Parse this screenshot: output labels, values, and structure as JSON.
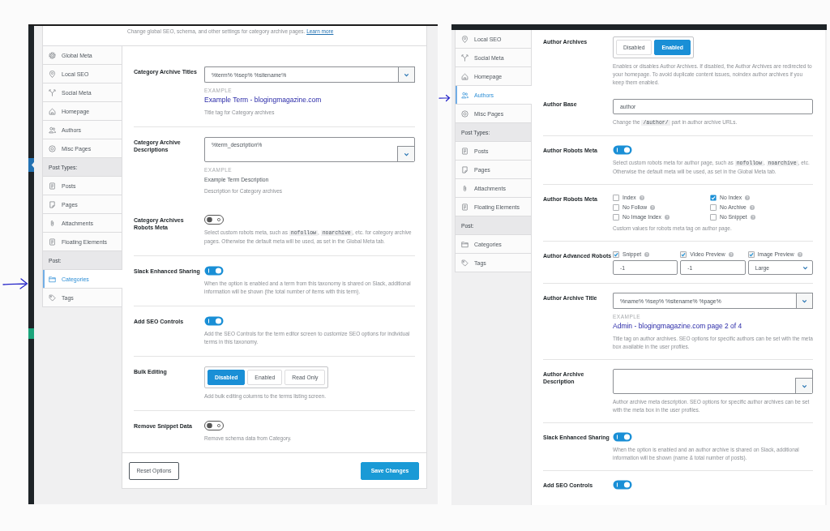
{
  "left_screenshot": {
    "header": {
      "text": "Change global SEO, schema, and other settings for category archive pages.",
      "link": "Learn more"
    },
    "sidebar": {
      "items": [
        {
          "kind": "link",
          "label": "Global Meta",
          "selected": false
        },
        {
          "kind": "link",
          "label": "Local SEO",
          "selected": false
        },
        {
          "kind": "link",
          "label": "Social Meta",
          "selected": false
        },
        {
          "kind": "link",
          "label": "Homepage",
          "selected": false
        },
        {
          "kind": "link",
          "label": "Authors",
          "selected": false
        },
        {
          "kind": "link",
          "label": "Misc Pages",
          "selected": false
        },
        {
          "kind": "heading",
          "label": "Post Types:"
        },
        {
          "kind": "link",
          "label": "Posts",
          "selected": false
        },
        {
          "kind": "link",
          "label": "Pages",
          "selected": false
        },
        {
          "kind": "link",
          "label": "Attachments",
          "selected": false
        },
        {
          "kind": "link",
          "label": "Floating Elements",
          "selected": false
        },
        {
          "kind": "heading",
          "label": "Post:"
        },
        {
          "kind": "link",
          "label": "Categories",
          "selected": true
        },
        {
          "kind": "link",
          "label": "Tags",
          "selected": false
        }
      ]
    },
    "sections": [
      {
        "rows": [
          {
            "kind": "select",
            "label": "Category Archive Titles",
            "value": "%term% %sep% %sitename%",
            "example_label": "EXAMPLE",
            "example": "Example Term - blogingmagazine.com",
            "description": "Title tag for Category archives"
          }
        ]
      },
      {
        "rows": [
          {
            "kind": "textarea",
            "label": "Category Archive Descriptions",
            "value": "%term_description%",
            "example_label": "EXAMPLE",
            "example": "Example Term Description",
            "description": "Description for Category archives"
          },
          {
            "kind": "toggle",
            "label": "Category Archives Robots Meta",
            "on": false,
            "description": [
              {
                "kind": "text",
                "text": "Select custom robots meta, such as "
              },
              {
                "kind": "code",
                "text": "nofollow"
              },
              {
                "kind": "text",
                "text": ", "
              },
              {
                "kind": "code",
                "text": "noarchive"
              },
              {
                "kind": "text",
                "text": ", etc. for category archive pages. Otherwise the default meta will be used, as set in the Global Meta tab."
              }
            ]
          }
        ]
      },
      {
        "rows": [
          {
            "kind": "toggle",
            "label": "Slack Enhanced Sharing",
            "on": true,
            "description": "When the option is enabled and a term from this taxonomy is shared on Slack, additional information will be shown (the total number of items with this term)."
          }
        ]
      },
      {
        "rows": [
          {
            "kind": "toggle",
            "label": "Add SEO Controls",
            "on": true,
            "description": "Add the SEO Controls for the term editor screen to customize SEO options for individual terms in this taxonomy."
          }
        ]
      },
      {
        "rows": [
          {
            "kind": "segmented",
            "label": "Bulk Editing",
            "options": [
              {
                "label": "Disabled",
                "selected": true
              },
              {
                "label": "Enabled",
                "selected": false
              },
              {
                "label": "Read Only",
                "selected": false
              }
            ],
            "description": "Add bulk editing columns to the terms listing screen."
          }
        ]
      },
      {
        "rows": [
          {
            "kind": "toggle",
            "label": "Remove Snippet Data",
            "on": false,
            "description": "Remove schema data from Category."
          }
        ]
      }
    ],
    "footer": {
      "buttons": [
        {
          "kind": "secondary",
          "label": "Reset Options"
        },
        {
          "kind": "primary",
          "label": "Save Changes"
        }
      ]
    }
  },
  "right_screenshot": {
    "sidebar": {
      "items": [
        {
          "kind": "link",
          "label": "Local SEO",
          "selected": false
        },
        {
          "kind": "link",
          "label": "Social Meta",
          "selected": false
        },
        {
          "kind": "link",
          "label": "Homepage",
          "selected": false
        },
        {
          "kind": "link",
          "label": "Authors",
          "selected": true
        },
        {
          "kind": "link",
          "label": "Misc Pages",
          "selected": false
        },
        {
          "kind": "heading",
          "label": "Post Types:"
        },
        {
          "kind": "link",
          "label": "Posts",
          "selected": false
        },
        {
          "kind": "link",
          "label": "Pages",
          "selected": false
        },
        {
          "kind": "link",
          "label": "Attachments",
          "selected": false
        },
        {
          "kind": "link",
          "label": "Floating Elements",
          "selected": false
        },
        {
          "kind": "heading",
          "label": "Post:"
        },
        {
          "kind": "link",
          "label": "Categories",
          "selected": false
        },
        {
          "kind": "link",
          "label": "Tags",
          "selected": false
        }
      ]
    },
    "sections": [
      {
        "rows": [
          {
            "kind": "segmented",
            "label": "Author Archives",
            "options": [
              {
                "label": "Disabled",
                "selected": false
              },
              {
                "label": "Enabled",
                "selected": true
              }
            ],
            "description": "Enables or disables Author Archives. If disabled, the Author Archives are redirected to your homepage. To avoid duplicate content issues, noindex author archives if you keep them enabled."
          },
          {
            "kind": "input",
            "label": "Author Base",
            "value": "author",
            "description": [
              {
                "kind": "text",
                "text": "Change the "
              },
              {
                "kind": "code",
                "text": "/author/"
              },
              {
                "kind": "text",
                "text": " part in author archive URLs."
              }
            ]
          }
        ]
      },
      {
        "rows": [
          {
            "kind": "toggle",
            "label": "Author Robots Meta",
            "on": true,
            "description": [
              {
                "kind": "text",
                "text": "Select custom robots meta for author page, such as "
              },
              {
                "kind": "code",
                "text": "nofollow"
              },
              {
                "kind": "text",
                "text": ", "
              },
              {
                "kind": "code",
                "text": "noarchive"
              },
              {
                "kind": "text",
                "text": ", etc. Otherwise the default meta will be used, as set in the Global Meta tab."
              }
            ]
          }
        ]
      },
      {
        "rows": [
          {
            "kind": "checkbox-grid",
            "label": "Author Robots Meta",
            "columns": [
              [
                {
                  "label": "Index",
                  "checked": false
                },
                {
                  "label": "No Follow",
                  "checked": false
                },
                {
                  "label": "No Image Index",
                  "checked": false
                }
              ],
              [
                {
                  "label": "No Index",
                  "checked": true
                },
                {
                  "label": "No Archive",
                  "checked": false
                },
                {
                  "label": "No Snippet",
                  "checked": false
                }
              ]
            ],
            "description": "Custom values for robots meta tag on author page."
          }
        ]
      },
      {
        "rows": [
          {
            "kind": "advanced",
            "label": "Author Advanced Robots",
            "items": [
              {
                "kind": "input",
                "label": "Snippet",
                "checked": true,
                "value": "-1"
              },
              {
                "kind": "input",
                "label": "Video Preview",
                "checked": true,
                "value": "-1"
              },
              {
                "kind": "select",
                "label": "Image Preview",
                "checked": true,
                "value": "Large"
              }
            ]
          }
        ]
      },
      {
        "rows": [
          {
            "kind": "select",
            "label": "Author Archive Title",
            "value": "%name% %sep% %sitename% %page%",
            "example_label": "EXAMPLE",
            "example": "Admin - blogingmagazine.com page 2 of 4",
            "description": "Title tag on author archives. SEO options for specific authors can be set with the meta box available in the user profiles."
          }
        ]
      },
      {
        "rows": [
          {
            "kind": "textarea",
            "label": "Author Archive Description",
            "description": "Author archive meta description. SEO options for specific author archives can be set with the meta box in the user profiles."
          }
        ]
      },
      {
        "rows": [
          {
            "kind": "toggle",
            "label": "Slack Enhanced Sharing",
            "on": true,
            "description": "When the option is enabled and an author archive is shared on Slack, additional information will be shown (name & total number of posts)."
          }
        ]
      },
      {
        "rows": [
          {
            "kind": "toggle",
            "label": "Add SEO Controls",
            "on": true
          }
        ]
      }
    ]
  }
}
